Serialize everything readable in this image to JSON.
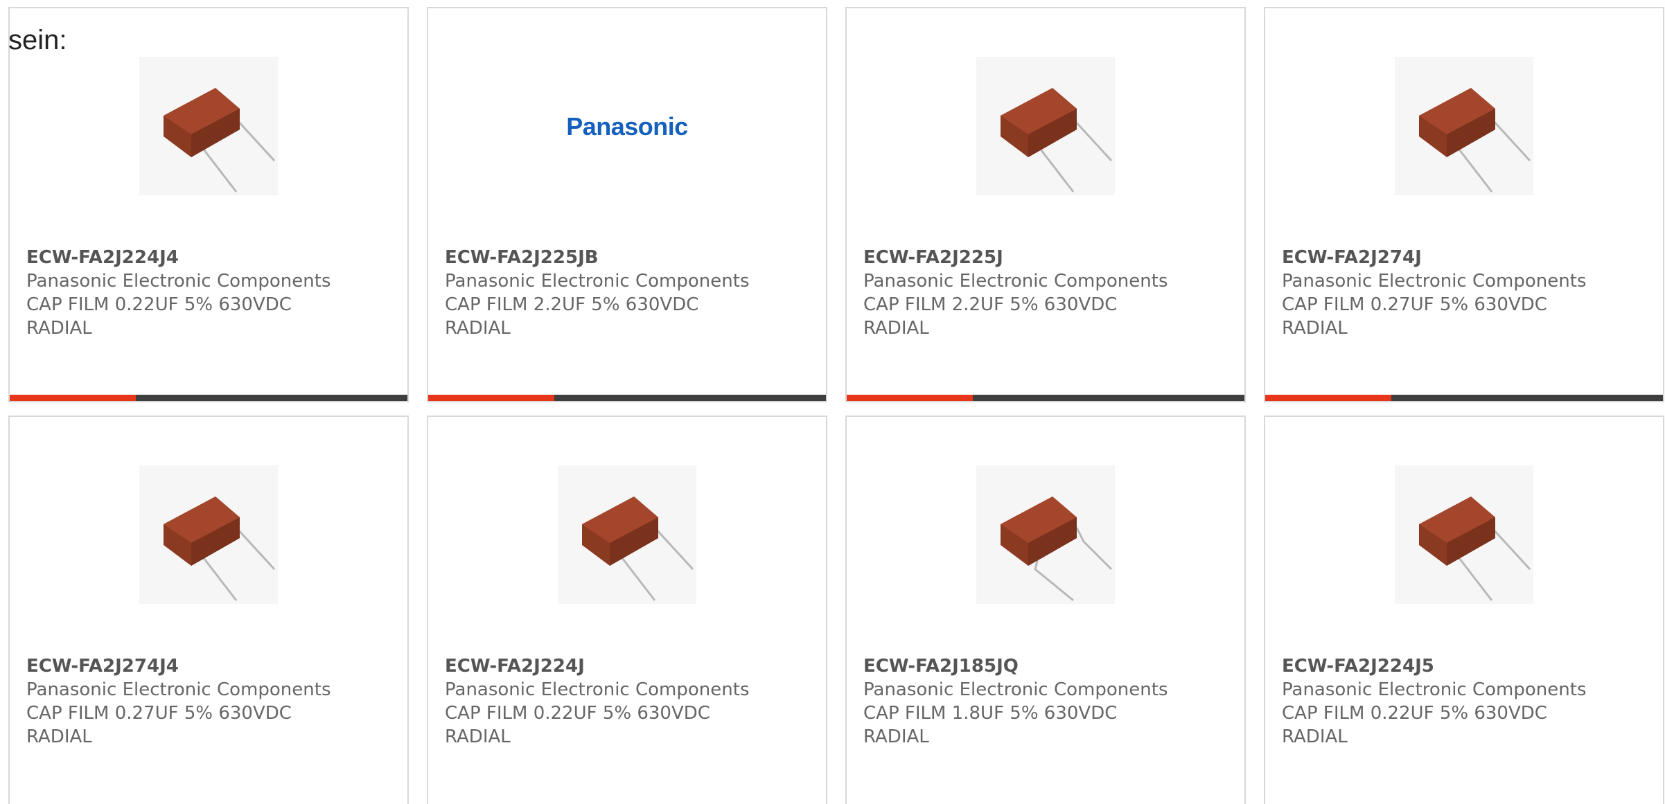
{
  "intro_text": "sein:",
  "colors": {
    "accent": "#e8361a",
    "bar": "#3e3e3e",
    "capacitor": "#8b3a22",
    "panasonic_blue": "#1560bd"
  },
  "products": [
    {
      "part": "ECW-FA2J224J4",
      "manufacturer": "Panasonic Electronic Components",
      "desc1": "CAP FILM 0.22UF 5% 630VDC",
      "desc2": "RADIAL",
      "image": "capacitor-image"
    },
    {
      "part": "ECW-FA2J225JB",
      "manufacturer": "Panasonic Electronic Components",
      "desc1": "CAP FILM 2.2UF 5% 630VDC",
      "desc2": "RADIAL",
      "image": "panasonic-logo",
      "logo_text": "Panasonic"
    },
    {
      "part": "ECW-FA2J225J",
      "manufacturer": "Panasonic Electronic Components",
      "desc1": "CAP FILM 2.2UF 5% 630VDC",
      "desc2": "RADIAL",
      "image": "capacitor-image"
    },
    {
      "part": "ECW-FA2J274J",
      "manufacturer": "Panasonic Electronic Components",
      "desc1": "CAP FILM 0.27UF 5% 630VDC",
      "desc2": "RADIAL",
      "image": "capacitor-image"
    },
    {
      "part": "ECW-FA2J274J4",
      "manufacturer": "Panasonic Electronic Components",
      "desc1": "CAP FILM 0.27UF 5% 630VDC",
      "desc2": "RADIAL",
      "image": "capacitor-image"
    },
    {
      "part": "ECW-FA2J224J",
      "manufacturer": "Panasonic Electronic Components",
      "desc1": "CAP FILM 0.22UF 5% 630VDC",
      "desc2": "RADIAL",
      "image": "capacitor-image"
    },
    {
      "part": "ECW-FA2J185JQ",
      "manufacturer": "Panasonic Electronic Components",
      "desc1": "CAP FILM 1.8UF 5% 630VDC",
      "desc2": "RADIAL",
      "image": "capacitor-image"
    },
    {
      "part": "ECW-FA2J224J5",
      "manufacturer": "Panasonic Electronic Components",
      "desc1": "CAP FILM 0.22UF 5% 630VDC",
      "desc2": "RADIAL",
      "image": "capacitor-image"
    }
  ]
}
